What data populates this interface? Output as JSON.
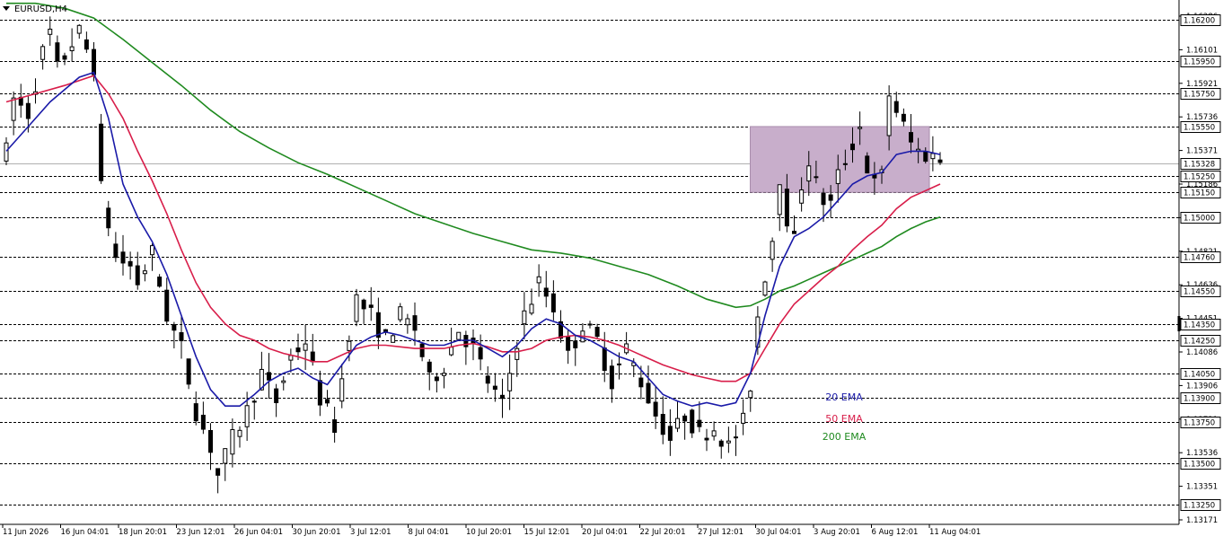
{
  "window": {
    "symbol_title": "EURUSD,H4",
    "menu_icon": "triangle-down-icon"
  },
  "colors": {
    "background": "#ffffff",
    "grid": "#000000",
    "candles": "#000000",
    "ema20": "#1a1aa8",
    "ema50": "#d81e4a",
    "ema200": "#1f8a1f",
    "zone_fill": "#c8aecb",
    "badge_bg": "#ffffff"
  },
  "legend": {
    "ema20": "20 EMA",
    "ema50": "50 EMA",
    "ema200": "200 EMA"
  },
  "chart_data": {
    "type": "candlestick",
    "symbol": "EURUSD",
    "timeframe": "H4",
    "ylim": [
      1.1313,
      1.1632
    ],
    "y_ticks": [
      "1.16286",
      "1.16101",
      "1.15921",
      "1.15736",
      "1.15371",
      "1.15186",
      "1.15001",
      "1.14821",
      "1.14636",
      "1.14451",
      "1.14086",
      "1.13906",
      "1.13721",
      "1.13536",
      "1.13351",
      "1.13171"
    ],
    "x_ticks": [
      "11 Jun 2026",
      "16 Jun 04:01",
      "18 Jun 20:01",
      "23 Jun 12:01",
      "26 Jun 04:01",
      "30 Jun 20:01",
      "3 Jul 12:01",
      "8 Jul 04:01",
      "10 Jul 20:01",
      "15 Jul 12:01",
      "20 Jul 04:01",
      "22 Jul 20:01",
      "27 Jul 12:01",
      "30 Jul 04:01",
      "3 Aug 20:01",
      "6 Aug 12:01",
      "11 Aug 04:01"
    ],
    "horizontal_levels": [
      {
        "label": "1.16200",
        "value": 1.162
      },
      {
        "label": "1.15950",
        "value": 1.1595
      },
      {
        "label": "1.15750",
        "value": 1.1575
      },
      {
        "label": "1.15550",
        "value": 1.1555
      },
      {
        "label": "1.15328",
        "value": 1.15328,
        "current": true
      },
      {
        "label": "1.15250",
        "value": 1.1525
      },
      {
        "label": "1.15150",
        "value": 1.1515
      },
      {
        "label": "1.15000",
        "value": 1.15
      },
      {
        "label": "1.14760",
        "value": 1.1476
      },
      {
        "label": "1.14550",
        "value": 1.1455
      },
      {
        "label": "1.14350",
        "value": 1.1435
      },
      {
        "label": "1.14250",
        "value": 1.1425
      },
      {
        "label": "1.14050",
        "value": 1.1405
      },
      {
        "label": "1.13900",
        "value": 1.139
      },
      {
        "label": "1.13750",
        "value": 1.1375
      },
      {
        "label": "1.13500",
        "value": 1.135
      },
      {
        "label": "1.13250",
        "value": 1.1325
      }
    ],
    "zone": {
      "from": 1.1515,
      "to": 1.1555,
      "start": "30 Jul 04:01",
      "end": "11 Aug 04:01"
    },
    "price_path": [
      [
        0,
        1.154
      ],
      [
        1,
        1.1572
      ],
      [
        3,
        1.1563
      ],
      [
        5,
        1.16
      ],
      [
        6,
        1.1612
      ],
      [
        7,
        1.159
      ],
      [
        9,
        1.1606
      ],
      [
        10,
        1.1612
      ],
      [
        12,
        1.1592
      ],
      [
        13,
        1.1517
      ],
      [
        15,
        1.1475
      ],
      [
        17,
        1.147
      ],
      [
        18,
        1.146
      ],
      [
        20,
        1.1478
      ],
      [
        22,
        1.144
      ],
      [
        24,
        1.142
      ],
      [
        26,
        1.1382
      ],
      [
        28,
        1.136
      ],
      [
        29,
        1.1343
      ],
      [
        31,
        1.1365
      ],
      [
        33,
        1.1382
      ],
      [
        35,
        1.1405
      ],
      [
        37,
        1.1388
      ],
      [
        39,
        1.1415
      ],
      [
        41,
        1.1425
      ],
      [
        43,
        1.139
      ],
      [
        45,
        1.1373
      ],
      [
        47,
        1.143
      ],
      [
        48,
        1.145
      ],
      [
        50,
        1.144
      ],
      [
        52,
        1.1425
      ],
      [
        54,
        1.144
      ],
      [
        56,
        1.1432
      ],
      [
        58,
        1.14
      ],
      [
        60,
        1.141
      ],
      [
        62,
        1.1432
      ],
      [
        64,
        1.142
      ],
      [
        66,
        1.14
      ],
      [
        68,
        1.1385
      ],
      [
        70,
        1.1425
      ],
      [
        71,
        1.144
      ],
      [
        73,
        1.146
      ],
      [
        75,
        1.1445
      ],
      [
        77,
        1.1415
      ],
      [
        79,
        1.1435
      ],
      [
        81,
        1.1425
      ],
      [
        83,
        1.14
      ],
      [
        85,
        1.142
      ],
      [
        87,
        1.14
      ],
      [
        89,
        1.138
      ],
      [
        91,
        1.1365
      ],
      [
        93,
        1.138
      ],
      [
        95,
        1.1368
      ],
      [
        97,
        1.1372
      ],
      [
        99,
        1.136
      ],
      [
        101,
        1.1375
      ],
      [
        102,
        1.1398
      ],
      [
        103,
        1.144
      ],
      [
        104,
        1.1465
      ],
      [
        105,
        1.1487
      ],
      [
        106,
        1.1525
      ],
      [
        107,
        1.15
      ],
      [
        108,
        1.1485
      ],
      [
        109,
        1.152
      ],
      [
        110,
        1.1535
      ],
      [
        111,
        1.152
      ],
      [
        112,
        1.151
      ],
      [
        113,
        1.1508
      ],
      [
        114,
        1.1525
      ],
      [
        115,
        1.1535
      ],
      [
        116,
        1.1545
      ],
      [
        117,
        1.1555
      ],
      [
        118,
        1.153
      ],
      [
        119,
        1.152
      ],
      [
        120,
        1.1525
      ],
      [
        121,
        1.1575
      ],
      [
        122,
        1.1565
      ],
      [
        123,
        1.1555
      ],
      [
        124,
        1.1545
      ],
      [
        125,
        1.154
      ],
      [
        126,
        1.1538
      ],
      [
        127,
        1.1537
      ],
      [
        128,
        1.1535
      ]
    ],
    "ema20_path": [
      [
        0,
        1.154
      ],
      [
        3,
        1.1555
      ],
      [
        6,
        1.157
      ],
      [
        10,
        1.1585
      ],
      [
        12,
        1.1588
      ],
      [
        14,
        1.156
      ],
      [
        16,
        1.152
      ],
      [
        18,
        1.15
      ],
      [
        20,
        1.1485
      ],
      [
        22,
        1.1465
      ],
      [
        24,
        1.144
      ],
      [
        26,
        1.1415
      ],
      [
        28,
        1.1395
      ],
      [
        30,
        1.1385
      ],
      [
        32,
        1.1385
      ],
      [
        34,
        1.1392
      ],
      [
        36,
        1.14
      ],
      [
        38,
        1.1405
      ],
      [
        40,
        1.1408
      ],
      [
        42,
        1.1402
      ],
      [
        44,
        1.1398
      ],
      [
        46,
        1.141
      ],
      [
        48,
        1.1422
      ],
      [
        50,
        1.1427
      ],
      [
        52,
        1.143
      ],
      [
        54,
        1.1428
      ],
      [
        56,
        1.1425
      ],
      [
        58,
        1.1422
      ],
      [
        60,
        1.1422
      ],
      [
        62,
        1.1425
      ],
      [
        64,
        1.1425
      ],
      [
        66,
        1.142
      ],
      [
        68,
        1.1415
      ],
      [
        70,
        1.1422
      ],
      [
        72,
        1.1432
      ],
      [
        74,
        1.1438
      ],
      [
        76,
        1.1435
      ],
      [
        78,
        1.1428
      ],
      [
        80,
        1.1425
      ],
      [
        82,
        1.142
      ],
      [
        84,
        1.1415
      ],
      [
        86,
        1.1412
      ],
      [
        88,
        1.1402
      ],
      [
        90,
        1.1392
      ],
      [
        92,
        1.1388
      ],
      [
        94,
        1.1385
      ],
      [
        96,
        1.1387
      ],
      [
        98,
        1.1385
      ],
      [
        100,
        1.1387
      ],
      [
        102,
        1.1405
      ],
      [
        104,
        1.144
      ],
      [
        106,
        1.147
      ],
      [
        108,
        1.1488
      ],
      [
        110,
        1.1493
      ],
      [
        112,
        1.15
      ],
      [
        114,
        1.151
      ],
      [
        116,
        1.152
      ],
      [
        118,
        1.1525
      ],
      [
        120,
        1.1527
      ],
      [
        122,
        1.1538
      ],
      [
        124,
        1.154
      ],
      [
        126,
        1.154
      ],
      [
        128,
        1.1538
      ]
    ],
    "ema50_path": [
      [
        0,
        1.157
      ],
      [
        4,
        1.1575
      ],
      [
        8,
        1.158
      ],
      [
        12,
        1.1586
      ],
      [
        14,
        1.1575
      ],
      [
        16,
        1.156
      ],
      [
        18,
        1.154
      ],
      [
        20,
        1.1522
      ],
      [
        22,
        1.1502
      ],
      [
        24,
        1.148
      ],
      [
        26,
        1.146
      ],
      [
        28,
        1.1445
      ],
      [
        30,
        1.1435
      ],
      [
        32,
        1.1428
      ],
      [
        34,
        1.1425
      ],
      [
        36,
        1.142
      ],
      [
        38,
        1.1417
      ],
      [
        40,
        1.1415
      ],
      [
        42,
        1.1412
      ],
      [
        44,
        1.1412
      ],
      [
        46,
        1.1416
      ],
      [
        48,
        1.142
      ],
      [
        50,
        1.1422
      ],
      [
        52,
        1.1422
      ],
      [
        54,
        1.1421
      ],
      [
        56,
        1.142
      ],
      [
        58,
        1.142
      ],
      [
        60,
        1.142
      ],
      [
        62,
        1.1422
      ],
      [
        64,
        1.1423
      ],
      [
        66,
        1.1421
      ],
      [
        68,
        1.1418
      ],
      [
        70,
        1.1418
      ],
      [
        72,
        1.142
      ],
      [
        74,
        1.1425
      ],
      [
        76,
        1.1427
      ],
      [
        78,
        1.1428
      ],
      [
        80,
        1.1427
      ],
      [
        82,
        1.1425
      ],
      [
        84,
        1.1422
      ],
      [
        86,
        1.1418
      ],
      [
        88,
        1.1414
      ],
      [
        90,
        1.141
      ],
      [
        92,
        1.1407
      ],
      [
        94,
        1.1404
      ],
      [
        96,
        1.1402
      ],
      [
        98,
        1.14
      ],
      [
        100,
        1.14
      ],
      [
        102,
        1.1405
      ],
      [
        104,
        1.142
      ],
      [
        106,
        1.1435
      ],
      [
        108,
        1.1447
      ],
      [
        110,
        1.1455
      ],
      [
        112,
        1.1463
      ],
      [
        114,
        1.147
      ],
      [
        116,
        1.148
      ],
      [
        118,
        1.1488
      ],
      [
        120,
        1.1495
      ],
      [
        122,
        1.1505
      ],
      [
        124,
        1.1512
      ],
      [
        126,
        1.1516
      ],
      [
        128,
        1.152
      ]
    ],
    "ema200_path": [
      [
        0,
        1.163
      ],
      [
        4,
        1.163
      ],
      [
        8,
        1.1627
      ],
      [
        12,
        1.1621
      ],
      [
        16,
        1.1608
      ],
      [
        20,
        1.1594
      ],
      [
        24,
        1.158
      ],
      [
        28,
        1.1565
      ],
      [
        32,
        1.1552
      ],
      [
        36,
        1.1542
      ],
      [
        40,
        1.1533
      ],
      [
        44,
        1.1526
      ],
      [
        48,
        1.1518
      ],
      [
        52,
        1.151
      ],
      [
        56,
        1.1502
      ],
      [
        60,
        1.1496
      ],
      [
        64,
        1.149
      ],
      [
        68,
        1.1485
      ],
      [
        72,
        1.148
      ],
      [
        76,
        1.1478
      ],
      [
        80,
        1.1475
      ],
      [
        84,
        1.147
      ],
      [
        88,
        1.1465
      ],
      [
        92,
        1.1458
      ],
      [
        96,
        1.145
      ],
      [
        100,
        1.1445
      ],
      [
        102,
        1.1446
      ],
      [
        104,
        1.145
      ],
      [
        106,
        1.1455
      ],
      [
        108,
        1.1458
      ],
      [
        110,
        1.1462
      ],
      [
        112,
        1.1466
      ],
      [
        114,
        1.147
      ],
      [
        116,
        1.1474
      ],
      [
        118,
        1.1478
      ],
      [
        120,
        1.1482
      ],
      [
        122,
        1.1488
      ],
      [
        124,
        1.1493
      ],
      [
        126,
        1.1497
      ],
      [
        128,
        1.15
      ]
    ]
  }
}
